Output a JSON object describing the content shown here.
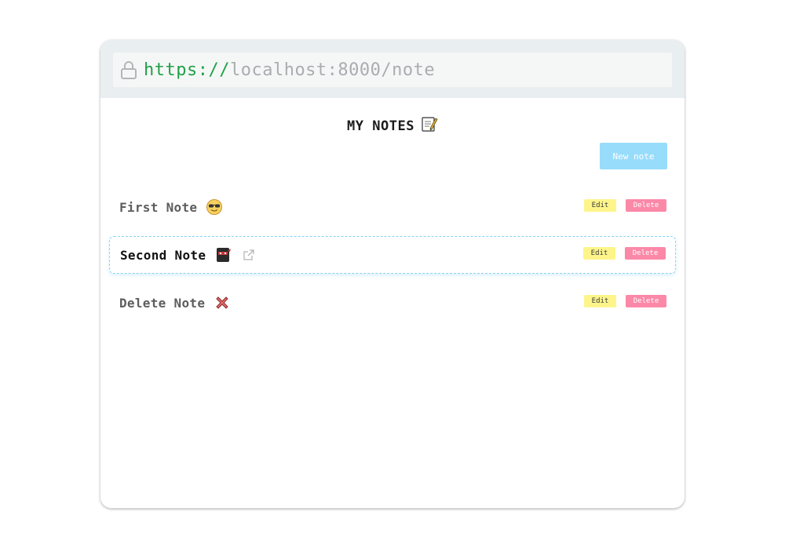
{
  "browser": {
    "url_scheme": "https://",
    "url_rest": "localhost:8000/note"
  },
  "page": {
    "title": "MY NOTES",
    "title_icon": "memo-emoji",
    "new_note_label": "New note"
  },
  "notes": [
    {
      "title": "First Note",
      "emoji": "sunglasses-face-emoji",
      "edit_label": "Edit",
      "delete_label": "Delete",
      "selected": false
    },
    {
      "title": "Second Note",
      "emoji": "ninja-emoji",
      "edit_label": "Edit",
      "delete_label": "Delete",
      "selected": true,
      "has_external_link": true
    },
    {
      "title": "Delete Note",
      "emoji": "cross-mark-emoji",
      "edit_label": "Edit",
      "delete_label": "Delete",
      "selected": false
    }
  ],
  "colors": {
    "scheme_green": "#22a047",
    "new_note_bg": "#98dcfb",
    "edit_bg": "#fdf58a",
    "delete_bg": "#fc88a8",
    "selected_border": "#8fd3f4"
  }
}
